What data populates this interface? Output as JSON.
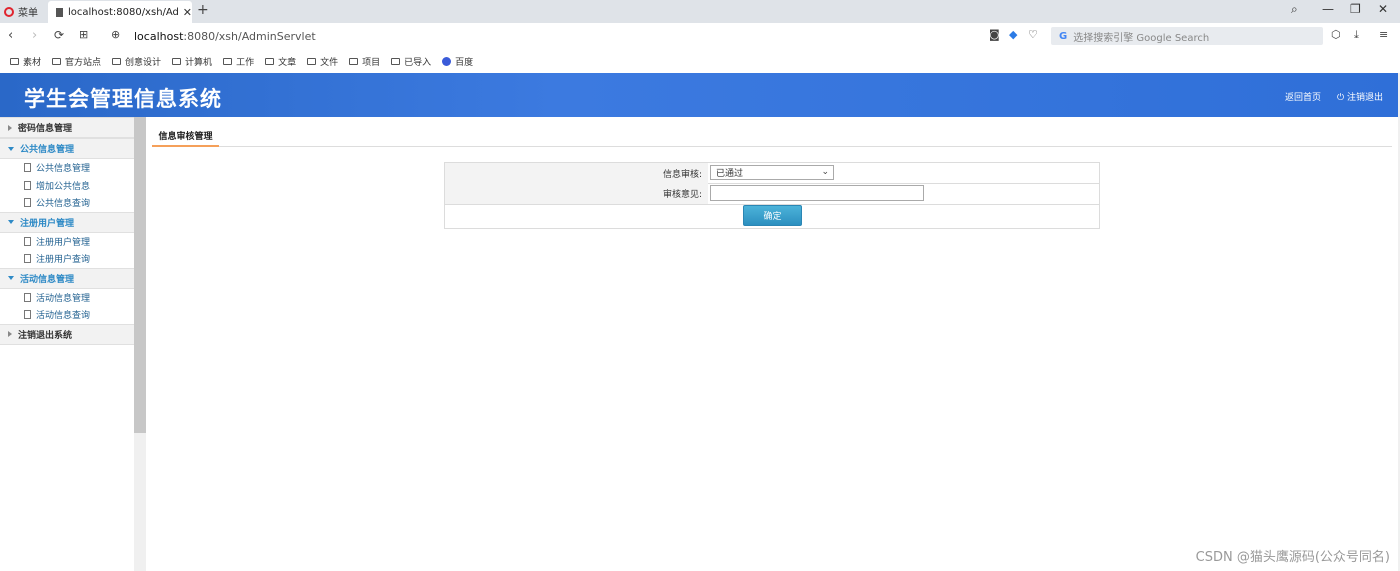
{
  "browser": {
    "menu_label": "菜单",
    "tab_title": "localhost:8080/xsh/Admin",
    "tab_close": "✕",
    "new_tab": "+",
    "url_host": "localhost",
    "url_path": ":8080/xsh/AdminServlet",
    "search_placeholder": "选择搜索引擎 Google Search",
    "bookmarks": [
      "素材",
      "官方站点",
      "创意设计",
      "计算机",
      "工作",
      "文章",
      "文件",
      "项目",
      "已导入",
      "百度"
    ]
  },
  "header": {
    "title": "学生会管理信息系统",
    "home_link": "返回首页",
    "logout_link": "注销退出"
  },
  "sidebar": {
    "groups": [
      {
        "label": "密码信息管理",
        "open": false,
        "items": []
      },
      {
        "label": "公共信息管理",
        "open": true,
        "items": [
          "公共信息管理",
          "增加公共信息",
          "公共信息查询"
        ]
      },
      {
        "label": "注册用户管理",
        "open": true,
        "items": [
          "注册用户管理",
          "注册用户查询"
        ]
      },
      {
        "label": "活动信息管理",
        "open": true,
        "items": [
          "活动信息管理",
          "活动信息查询"
        ]
      },
      {
        "label": "注销退出系统",
        "open": false,
        "items": []
      }
    ]
  },
  "main": {
    "tab_label": "信息审核管理",
    "form": {
      "review_label": "信息审核:",
      "review_value": "已通过",
      "opinion_label": "审核意见:",
      "opinion_value": "",
      "submit_label": "确定"
    }
  },
  "watermark": "CSDN @猫头鹰源码(公众号同名)"
}
